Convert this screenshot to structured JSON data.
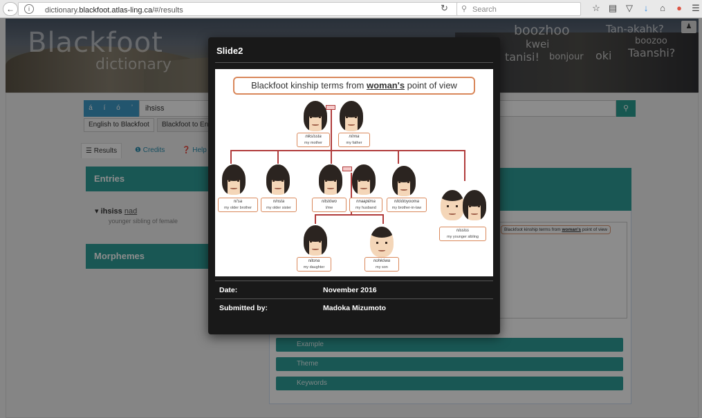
{
  "browser": {
    "url_prefix": "dictionary.",
    "url_domain": "blackfoot.atlas-ling.ca",
    "url_path": "/#/results",
    "search_placeholder": "Search"
  },
  "banner": {
    "title": "Blackfoot",
    "subtitle": "dictionary",
    "greetings": [
      "Tan-əkahk?",
      "boozhoo",
      "kwei",
      "boozoo",
      "tanisi!",
      "bonjour",
      "oki",
      "Taanshi?"
    ]
  },
  "search": {
    "chars": [
      "á",
      "í",
      "ó",
      "ʼ"
    ],
    "query": "ihsiss",
    "direction_tabs": [
      "English to Blackfoot",
      "Blackfoot to English"
    ]
  },
  "nav_tabs": [
    "Results",
    "Credits",
    "Help"
  ],
  "panels": {
    "entries": "Entries",
    "morphemes": "Morphemes"
  },
  "entry": {
    "headword": "ihsiss",
    "pos": "nad",
    "gloss": "younger sibling of female"
  },
  "accordion": [
    "Example",
    "Theme",
    "Keywords"
  ],
  "modal": {
    "title": "Slide2",
    "slide_title_pre": "Blackfoot kinship terms from ",
    "slide_title_em": "woman's",
    "slide_title_post": " point of view",
    "people": [
      {
        "term": "niksíssta",
        "gloss": "my mother"
      },
      {
        "term": "nínna",
        "gloss": "my father"
      },
      {
        "term": "ni'sa",
        "gloss": "my older brother"
      },
      {
        "term": "nínsta",
        "gloss": "my older sister"
      },
      {
        "term": "nitstówo",
        "gloss": "I/me"
      },
      {
        "term": "nnaapiima",
        "gloss": "my husband"
      },
      {
        "term": "nitóótoyooma",
        "gloss": "my brother-in-law"
      },
      {
        "term": "nississ",
        "gloss": "my younger sibling"
      },
      {
        "term": "nitona",
        "gloss": "my daughter"
      },
      {
        "term": "nohkówa",
        "gloss": "my son"
      }
    ],
    "meta": [
      {
        "key": "Date:",
        "value": "November 2016"
      },
      {
        "key": "Submitted by:",
        "value": "Madoka Mizumoto"
      }
    ]
  }
}
